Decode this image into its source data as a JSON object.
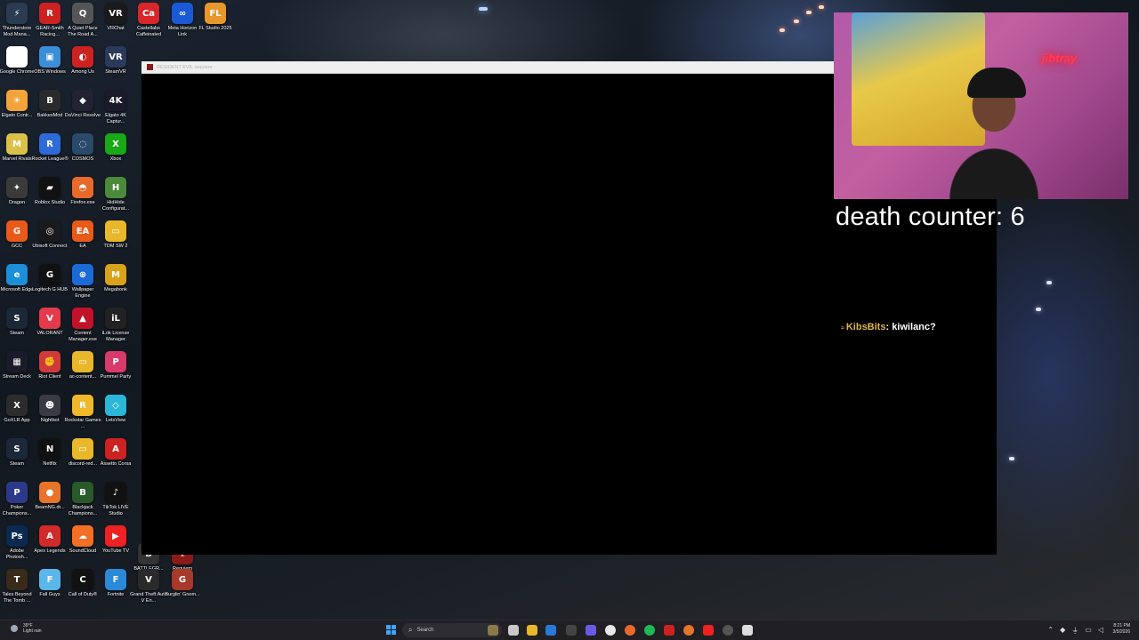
{
  "desktop": {
    "icons": [
      {
        "label": "Thunderstore Mod Mana...",
        "color": "#2a3b52",
        "glyph": "⚡"
      },
      {
        "label": "Google Chrome",
        "color": "#ffffff",
        "glyph": "◉"
      },
      {
        "label": "Elgato Contr...",
        "color": "#f2a33a",
        "glyph": "☀"
      },
      {
        "label": "Marvel Rivals",
        "color": "#d9c14a",
        "glyph": "M"
      },
      {
        "label": "Dragon",
        "color": "#3a3a3a",
        "glyph": "✦"
      },
      {
        "label": "GCC",
        "color": "#e85a1a",
        "glyph": "G"
      },
      {
        "label": "Microsoft Edge",
        "color": "#1c8fd8",
        "glyph": "e"
      },
      {
        "label": "Steam",
        "color": "#1b2838",
        "glyph": "S"
      },
      {
        "label": "Stream Deck",
        "color": "#1a1a2a",
        "glyph": "▦"
      },
      {
        "label": "GoXLR App",
        "color": "#2c2c2c",
        "glyph": "X"
      },
      {
        "label": "Steam",
        "color": "#1b2838",
        "glyph": "S"
      },
      {
        "label": "Poker Champions...",
        "color": "#2b3a88",
        "glyph": "P"
      },
      {
        "label": "Adobe Photosh...",
        "color": "#0a2a52",
        "glyph": "Ps"
      },
      {
        "label": "Tales Beyond The Tomb ...",
        "color": "#3a2a1a",
        "glyph": "T"
      },
      {
        "label": "GEAR-Smith Racing...",
        "color": "#c22",
        "glyph": "R"
      },
      {
        "label": "OBS Windows",
        "color": "#3a8fd8",
        "glyph": "▣"
      },
      {
        "label": "BakkesMod",
        "color": "#2a2a2a",
        "glyph": "B"
      },
      {
        "label": "Rocket League®",
        "color": "#2f6bd8",
        "glyph": "R"
      },
      {
        "label": "Roblox Studio",
        "color": "#111",
        "glyph": "▰"
      },
      {
        "label": "Ubisoft Connect",
        "color": "#1a1a1a",
        "glyph": "◎"
      },
      {
        "label": "Logitech G HUB",
        "color": "#111",
        "glyph": "G"
      },
      {
        "label": "VALORANT",
        "color": "#e33b4b",
        "glyph": "V"
      },
      {
        "label": "Riot Client",
        "color": "#d13a3a",
        "glyph": "✊"
      },
      {
        "label": "Nightbot",
        "color": "#3a3a44",
        "glyph": "☻"
      },
      {
        "label": "Netflix",
        "color": "#111",
        "glyph": "N"
      },
      {
        "label": "BeamNG.dr...",
        "color": "#e8732a",
        "glyph": "●"
      },
      {
        "label": "Apex Legends",
        "color": "#d12a2a",
        "glyph": "A"
      },
      {
        "label": "Fall Guys",
        "color": "#5ab7e8",
        "glyph": "F"
      },
      {
        "label": "A Quiet Place The Road A...",
        "color": "#555",
        "glyph": "Q"
      },
      {
        "label": "Among Us",
        "color": "#c22",
        "glyph": "◐"
      },
      {
        "label": "DaVinci Resolve",
        "color": "#223",
        "glyph": "◆"
      },
      {
        "label": "COSMOS",
        "color": "#2a4a6a",
        "glyph": "◌"
      },
      {
        "label": "Firefox.exe",
        "color": "#e86a2a",
        "glyph": "◓"
      },
      {
        "label": "EA",
        "color": "#e85a1a",
        "glyph": "EA"
      },
      {
        "label": "Wallpaper Engine",
        "color": "#1a6ad8",
        "glyph": "⊕"
      },
      {
        "label": "Content Manager.exe",
        "color": "#c2122a",
        "glyph": "▲"
      },
      {
        "label": "ac-content...",
        "color": "#e8b82a",
        "glyph": "▭"
      },
      {
        "label": "Rockstar Games ...",
        "color": "#f0b82a",
        "glyph": "R"
      },
      {
        "label": "discord-red...",
        "color": "#e8b82a",
        "glyph": "▭"
      },
      {
        "label": "Blackjack Champions...",
        "color": "#2a5a2a",
        "glyph": "B"
      },
      {
        "label": "SoundCloud",
        "color": "#f26f23",
        "glyph": "☁"
      },
      {
        "label": "Call of Duty®",
        "color": "#111",
        "glyph": "C"
      },
      {
        "label": "VRChat",
        "color": "#1a1a1a",
        "glyph": "VR"
      },
      {
        "label": "SteamVR",
        "color": "#2a3a5a",
        "glyph": "VR"
      },
      {
        "label": "Elgato 4K Captur...",
        "color": "#1a1a2a",
        "glyph": "4K"
      },
      {
        "label": "Xbox",
        "color": "#18a818",
        "glyph": "X"
      },
      {
        "label": "HidHide Configurat...",
        "color": "#4a8a3a",
        "glyph": "H"
      },
      {
        "label": "TDM SW 2",
        "color": "#e8b82a",
        "glyph": "▭"
      },
      {
        "label": "Megabonk",
        "color": "#d8a21a",
        "glyph": "M"
      },
      {
        "label": "iLok License Manager",
        "color": "#222",
        "glyph": "iL"
      },
      {
        "label": "Pummel Party",
        "color": "#d83a6a",
        "glyph": "P"
      },
      {
        "label": "LetsView",
        "color": "#2ab7d8",
        "glyph": "◇"
      },
      {
        "label": "Assetto Corsa",
        "color": "#c22",
        "glyph": "A"
      },
      {
        "label": "TikTok LIVE Studio",
        "color": "#111",
        "glyph": "♪"
      },
      {
        "label": "YouTube TV",
        "color": "#e22",
        "glyph": "▶"
      },
      {
        "label": "Fortnite",
        "color": "#2a8ad8",
        "glyph": "F"
      },
      {
        "label": "Castellabs Caffeinated",
        "color": "#d8262a",
        "glyph": "Ca"
      },
      {
        "label": "BATTLEGR...",
        "color": "#333",
        "glyph": "B"
      },
      {
        "label": "Grand Theft Auto V En...",
        "color": "#2a2a2a",
        "glyph": "V"
      },
      {
        "label": "Meta Horizon Link",
        "color": "#1a5ad8",
        "glyph": "∞"
      },
      {
        "label": "Requiem",
        "color": "#8a1a1a",
        "glyph": "☣"
      },
      {
        "label": "Burglin' Gnom...",
        "color": "#a8382a",
        "glyph": "G"
      },
      {
        "label": "FL Studio 2025",
        "color": "#e8982a",
        "glyph": "FL"
      }
    ]
  },
  "game_window": {
    "title": "RESIDENT EVIL requiem"
  },
  "overlay": {
    "death_counter": "death counter: 6",
    "neon_sign": "jibtray",
    "chat": {
      "badge": "≈",
      "user": "KibsBits",
      "message": ": kiwilanc?"
    }
  },
  "taskbar": {
    "weather_temp": "39°F",
    "weather_desc": "Light rain",
    "search_placeholder": "Search",
    "time": "8:21 PM",
    "date": "3/5/2026"
  }
}
